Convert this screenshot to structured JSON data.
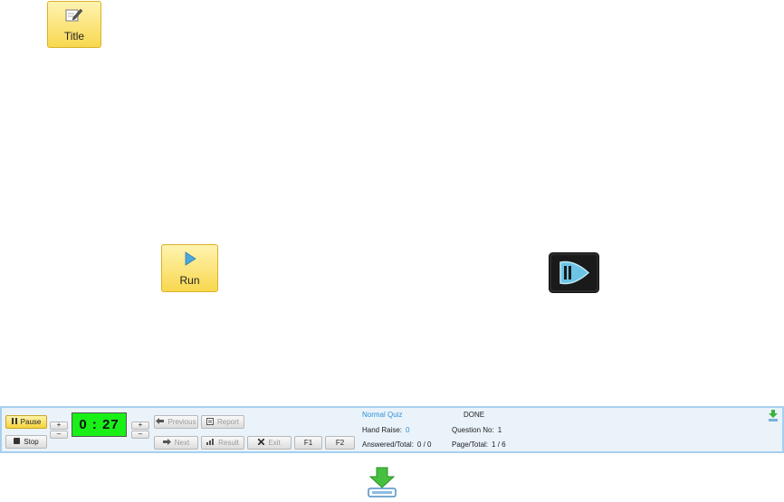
{
  "buttons": {
    "title_label": "Title",
    "run_label": "Run"
  },
  "toolbar": {
    "pause_label": "Pause",
    "stop_label": "Stop",
    "plus": "+",
    "minus": "–",
    "timer": "0 : 27",
    "previous_label": "Previous",
    "report_label": "Report",
    "next_label": "Next",
    "result_label": "Result",
    "exit_label": "Exit",
    "f1_label": "F1",
    "f2_label": "F2"
  },
  "status": {
    "quiz_type": "Normal Quiz",
    "state": "DONE",
    "hand_raise_label": "Hand Raise:",
    "hand_raise_value": "0",
    "question_no_label": "Question No:",
    "question_no_value": "1",
    "answered_label": "Answered/Total:",
    "answered_value": "0 / 0",
    "page_label": "Page/Total:",
    "page_value": "1 / 6"
  },
  "colors": {
    "accent_yellow": "#f8d84f",
    "timer_green": "#18f018",
    "toolbar_border": "#a6d0ee",
    "link_blue": "#2f8fd6"
  },
  "icons": [
    "pencil-icon",
    "play-icon",
    "media-play-icon",
    "download-icon",
    "pause-icon",
    "stop-icon",
    "arrow-left-icon",
    "arrow-right-icon",
    "report-icon",
    "chart-icon",
    "close-icon"
  ]
}
